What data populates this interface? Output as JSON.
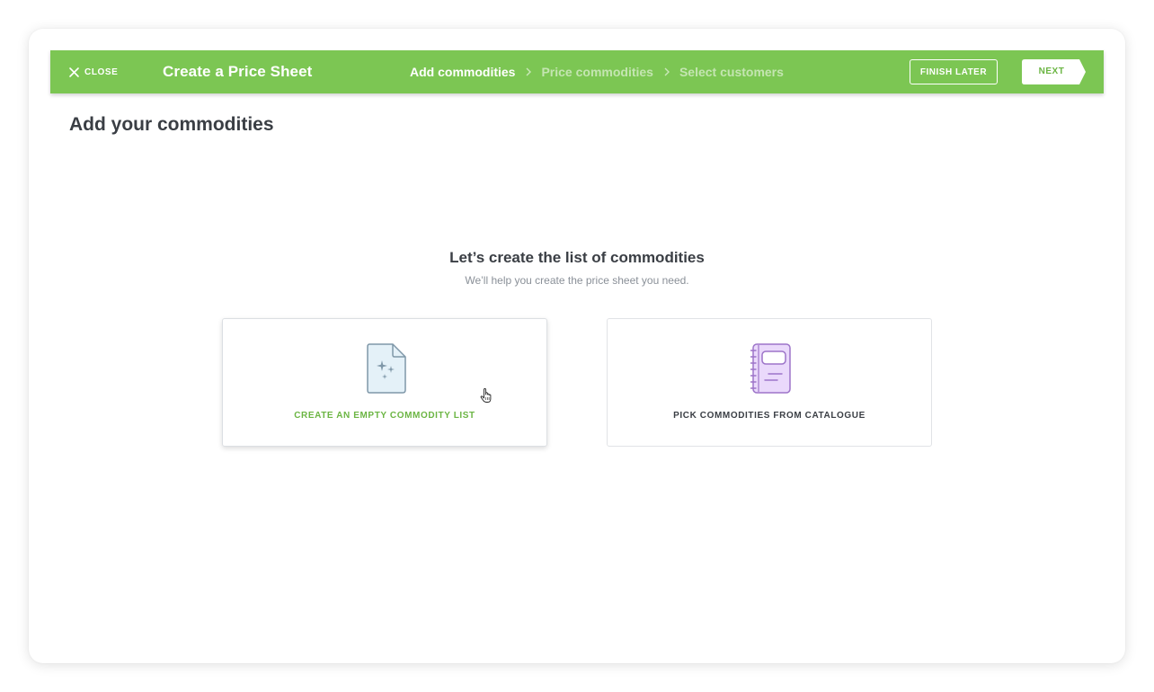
{
  "header": {
    "close_label": "CLOSE",
    "title": "Create a Price Sheet",
    "steps": [
      {
        "label": "Add commodities",
        "active": true
      },
      {
        "label": "Price commodities",
        "active": false
      },
      {
        "label": "Select customers",
        "active": false
      }
    ],
    "finish_later_label": "FINISH LATER",
    "next_label": "NEXT"
  },
  "page": {
    "heading": "Add your commodities"
  },
  "intro": {
    "title": "Let’s create the list of commodities",
    "subtitle": "We’ll help you create the price sheet you need."
  },
  "options": [
    {
      "label": "CREATE AN EMPTY COMMODITY LIST",
      "icon": "sparkle-document-icon",
      "hovered": true
    },
    {
      "label": "PICK COMMODITIES FROM CATALOGUE",
      "icon": "notebook-icon",
      "hovered": false
    }
  ],
  "colors": {
    "brand_green": "#7cc653",
    "accent_green_text": "#6bb543",
    "heading_text": "#3a3e44",
    "muted_text": "#8a9098",
    "doc_icon_fill": "#e4f1f8",
    "doc_icon_stroke": "#7f97a8",
    "notebook_icon_fill": "#ead9fb",
    "notebook_icon_stroke": "#9d74c9"
  }
}
